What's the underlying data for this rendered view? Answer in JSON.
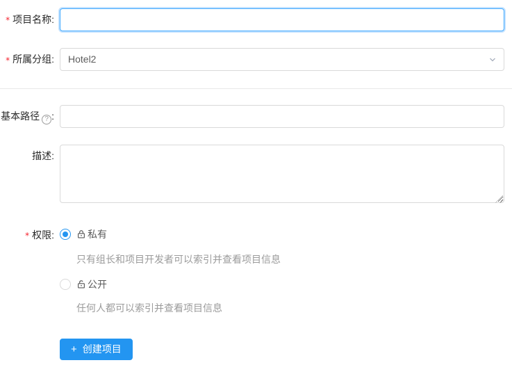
{
  "form": {
    "required_mark": "*",
    "colon": ":",
    "project_name": {
      "label": "项目名称",
      "required": true,
      "value": ""
    },
    "group": {
      "label": "所属分组",
      "required": true,
      "value": "Hotel2"
    },
    "base_path": {
      "label": "基本路径",
      "help_char": "?",
      "value": ""
    },
    "description": {
      "label": "描述",
      "value": ""
    },
    "permission": {
      "label": "权限",
      "required": true,
      "options": [
        {
          "label": "私有",
          "icon": "lock-icon",
          "selected": true,
          "description": "只有组长和项目开发者可以索引并查看项目信息"
        },
        {
          "label": "公开",
          "icon": "unlock-icon",
          "selected": false,
          "description": "任何人都可以索引并查看项目信息"
        }
      ]
    },
    "submit": {
      "plus_char": "+",
      "label": "创建项目"
    }
  },
  "colors": {
    "primary": "#2395f1",
    "focus_border": "#40a9ff",
    "input_border": "#d9d9d9",
    "divider": "#e8e8e8",
    "required_mark": "#f5222d",
    "muted_text": "#9b9b9b"
  }
}
